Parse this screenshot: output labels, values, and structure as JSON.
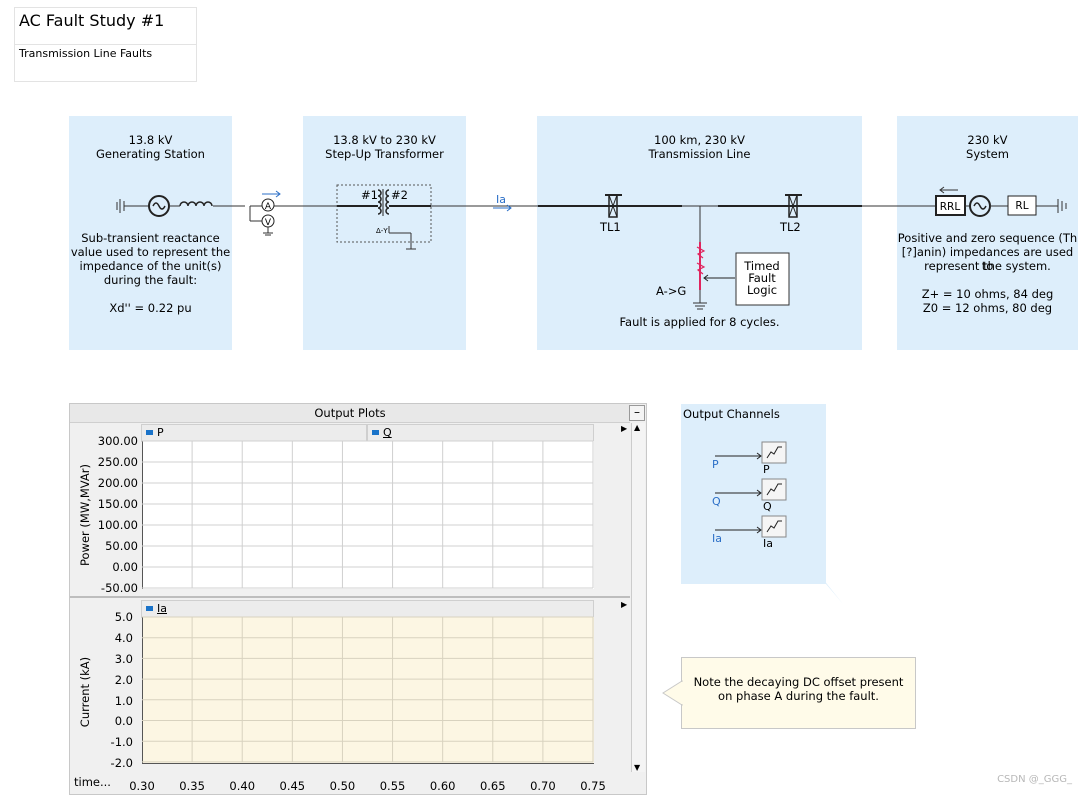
{
  "header": {
    "title": "AC Fault Study #1",
    "subtitle": "Transmission Line Faults"
  },
  "gen_panel": {
    "line1": "13.8 kV",
    "line2": "Generating Station",
    "desc": [
      "Sub-transient reactance",
      "value used to represent the",
      "impedance of the unit(s)",
      "during the fault:"
    ],
    "xd": "Xd'' = 0.22 pu"
  },
  "meters": {
    "ammeter": "A",
    "voltmeter": "V"
  },
  "xfmr_panel": {
    "line1": "13.8 kV to 230 kV",
    "line2": "Step-Up Transformer",
    "w1": "#1",
    "w2": "#2",
    "conn": "Δ-Y"
  },
  "ia_label": "Ia",
  "line_panel": {
    "line1": "100 km, 230 kV",
    "line2": "Transmission Line",
    "tl1": "TL1",
    "tl2": "TL2",
    "fault_type": "A->G",
    "timed_logic": [
      "Timed",
      "Fault",
      "Logic"
    ],
    "fault_note": "Fault is applied for 8 cycles."
  },
  "sys_panel": {
    "line1": "230 kV",
    "line2": "System",
    "rrl": "RRL",
    "rl": "RL",
    "desc": [
      "Positive and zero sequence (Th",
      "[?]anin) impedances are used to",
      "represent the system."
    ],
    "zpos": "Z+ = 10 ohms, 84 deg",
    "zzero": "Z0 = 12 ohms, 80 deg"
  },
  "plots": {
    "title": "Output Plots",
    "minimize": "–",
    "top": {
      "legend1": "P",
      "legend2": "Q",
      "ylabel": "Power (MW,MVAr)",
      "yticks": [
        "300.00",
        "250.00",
        "200.00",
        "150.00",
        "100.00",
        "50.00",
        "0.00",
        "-50.00"
      ]
    },
    "bottom": {
      "legend1": "Ia",
      "ylabel": "Current (kA)",
      "yticks": [
        "5.0",
        "4.0",
        "3.0",
        "2.0",
        "1.0",
        "0.0",
        "-1.0",
        "-2.0"
      ]
    },
    "xlabel": "time...",
    "xticks": [
      "0.30",
      "0.35",
      "0.40",
      "0.45",
      "0.50",
      "0.55",
      "0.60",
      "0.65",
      "0.70",
      "0.75"
    ]
  },
  "channels": {
    "title": "Output Channels",
    "items": [
      {
        "in": "P",
        "out": "P"
      },
      {
        "in": "Q",
        "out": "Q"
      },
      {
        "in": "Ia",
        "out": "Ia"
      }
    ]
  },
  "note": {
    "line1": "Note the decaying DC offset present",
    "line2": "on phase A during the fault."
  },
  "watermark": "CSDN @_GGG_",
  "colors": {
    "panel_bg": "#ddeefb",
    "plot_top_bg": "#ffffff",
    "plot_bottom_bg": "#fcf6e3",
    "fault_red": "#e0245e",
    "signal_blue": "#2b6fc7"
  }
}
